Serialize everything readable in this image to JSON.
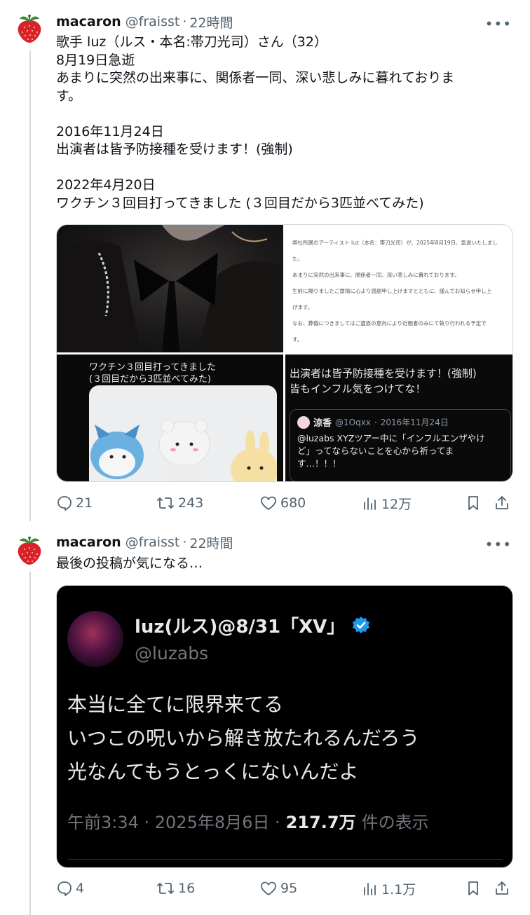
{
  "tweets": [
    {
      "author_name": "macaron",
      "author_handle": "@fraisst",
      "separator": "·",
      "time": "22時間",
      "more": "•••",
      "text": "歌手 luz（ルス・本名:帯刀光司）さん（32）\n8月19日急逝\nあまりに突然の出来事に、関係者一同、深い悲しみに暮れておりま\nす。\n\n2016年11月24日\n出演者は皆予防接種を受けます！(強制)\n\n2022年4月20日\nワクチン３回目打ってきました (３回目だから3匹並べてみた)",
      "media": {
        "doc_text": "弊社所属のアーティスト luz（本名：帯刀光司）が、2025年8月19日、急逝いたしまし\nた。\nあまりに突然の出来事に、関係者一同、深い悲しみに暮れております。\n生前に賜りましたご厚情に心より感謝申し上げますとともに、謹んでお知らせ申し上\nげます。\nなお、葬儀につきましてはご遺族の意向により近親者のみにて執り行われる予定で\nす。",
        "plush_caption": "ワクチン３回目打ってきました\n(３回目だから3匹並べてみた)",
        "quote_text": "出演者は皆予防接種を受けます！(強制)\n皆もインフル気をつけてな！",
        "quote_inner_name": "涼香",
        "quote_inner_handle": "@1Oqxx",
        "quote_inner_date": "2016年11月24日",
        "quote_inner_text": "@luzabs XYZツアー中に「インフルエンザやけ\nど」ってならないことを心から祈ってま\nす…！！！"
      },
      "stats": {
        "replies": "21",
        "retweets": "243",
        "likes": "680",
        "views": "12万"
      }
    },
    {
      "author_name": "macaron",
      "author_handle": "@fraisst",
      "separator": "·",
      "time": "22時間",
      "more": "•••",
      "text": "最後の投稿が気になる…",
      "screenshot": {
        "name": "luz(ルス)@8/31「XV」",
        "handle": "@luzabs",
        "text": "本当に全てに限界来てる\nいつこの呪いから解き放たれるんだろう\n光なんてもうとっくにないんだよ",
        "time": "午前3:34 · 2025年8月6日 ·",
        "views": "217.7万",
        "views_label": "件の表示"
      },
      "stats": {
        "replies": "4",
        "retweets": "16",
        "likes": "95",
        "views": "1.1万"
      }
    }
  ],
  "icons": [
    "strawberry-avatar",
    "reply-icon",
    "retweet-icon",
    "like-icon",
    "views-icon",
    "bookmark-icon",
    "share-icon",
    "verified-badge-icon"
  ],
  "colors": {
    "secondary_text": "#536471",
    "verified_blue": "#1d9bf0",
    "dark_bg": "#000000"
  }
}
